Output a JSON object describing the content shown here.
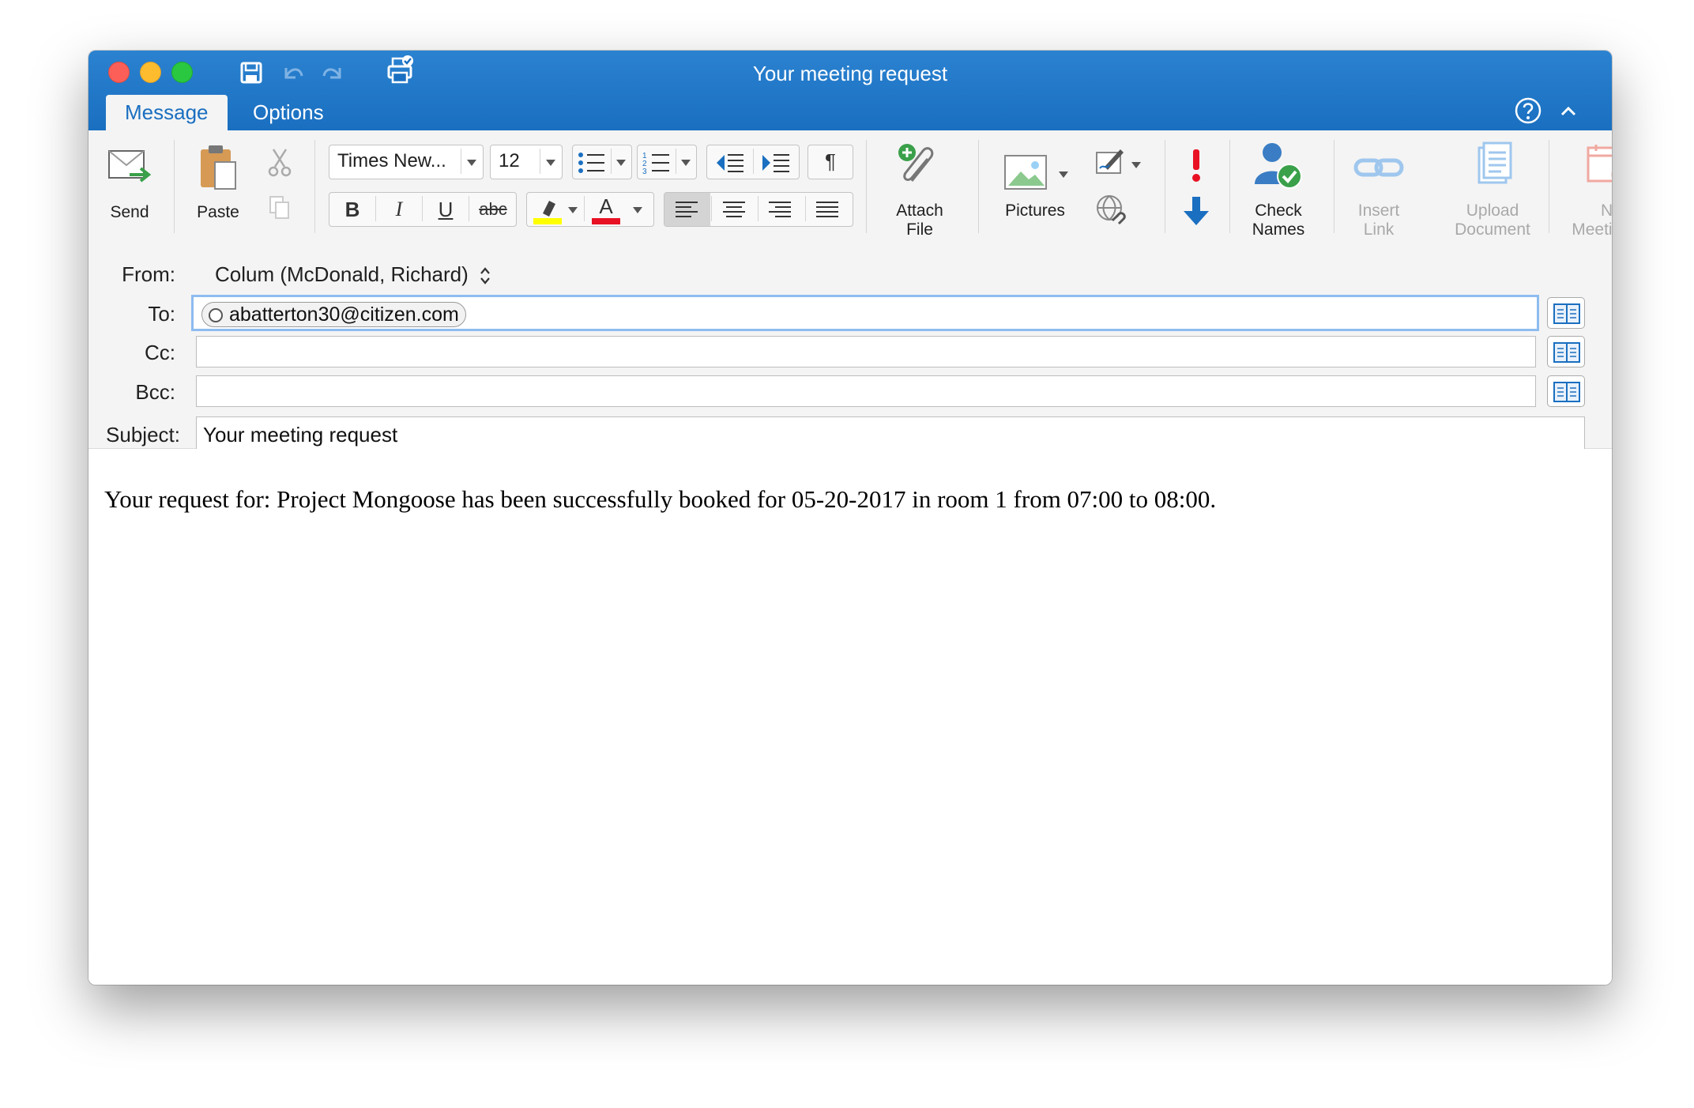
{
  "window": {
    "title": "Your meeting request"
  },
  "tabs": [
    {
      "label": "Message",
      "active": true
    },
    {
      "label": "Options",
      "active": false
    }
  ],
  "ribbon": {
    "send": "Send",
    "paste": "Paste",
    "font_name": "Times New...",
    "font_size": "12",
    "bold": "B",
    "italic": "I",
    "underline": "U",
    "strikethrough": "abc",
    "pilcrow": "¶",
    "attach_file": [
      "Attach",
      "File"
    ],
    "pictures": "Pictures",
    "check_names": [
      "Check",
      "Names"
    ],
    "insert_link": [
      "Insert",
      "Link"
    ],
    "upload_document": [
      "Upload",
      "Document"
    ],
    "new_meeting_poll": [
      "New",
      "Meeting Poll"
    ],
    "highlight_color": "#ffff00",
    "font_color": "#e81123"
  },
  "header": {
    "from_label": "From:",
    "from_value": "Colum (McDonald, Richard)",
    "to_label": "To:",
    "to_recipients": [
      "abatterton30@citizen.com"
    ],
    "cc_label": "Cc:",
    "bcc_label": "Bcc:",
    "subject_label": "Subject:",
    "subject_value": "Your meeting request"
  },
  "body": {
    "text": "Your request for: Project Mongoose has been successfully booked for 05-20-2017 in room 1 from 07:00 to 08:00."
  },
  "colors": {
    "titlebar": "#1a6fc0",
    "accent": "#1a6fc0",
    "ribbon_bg": "#f4f4f4"
  }
}
